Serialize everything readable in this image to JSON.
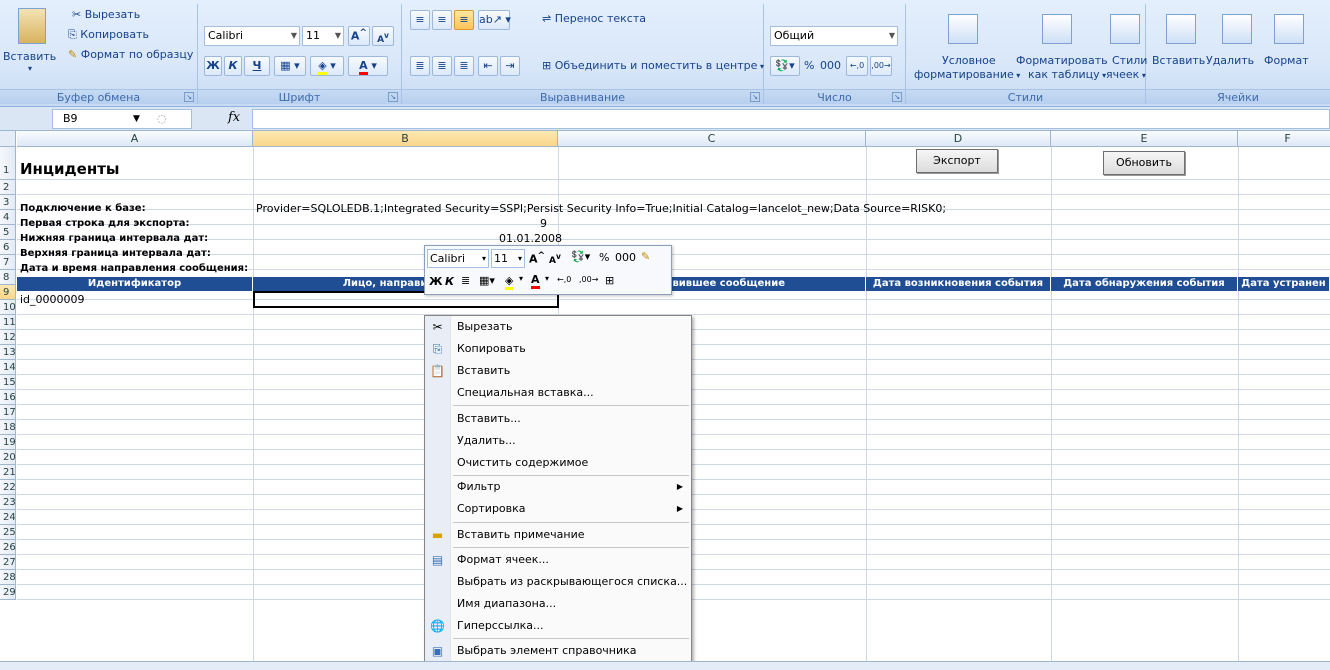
{
  "ribbon": {
    "clipboard": {
      "paste_label": "Вставить",
      "cut_label": "Вырезать",
      "copy_label": "Копировать",
      "format_painter_label": "Формат по образцу",
      "group_label": "Буфер обмена"
    },
    "font": {
      "font_name": "Calibri",
      "font_size": "11",
      "bold": "Ж",
      "italic": "К",
      "underline": "Ч",
      "group_label": "Шрифт"
    },
    "alignment": {
      "wrap_text_label": "Перенос текста",
      "merge_center_label": "Объединить и поместить в центре",
      "group_label": "Выравнивание"
    },
    "number": {
      "format_value": "Общий",
      "percent": "%",
      "thousands": "000",
      "group_label": "Число"
    },
    "styles": {
      "conditional_label_1": "Условное",
      "conditional_label_2": "форматирование",
      "format_table_label_1": "Форматировать",
      "format_table_label_2": "как таблицу",
      "cell_styles_label_1": "Стили",
      "cell_styles_label_2": "ячеек",
      "group_label": "Стили"
    },
    "cells": {
      "insert_label": "Вставить",
      "delete_label": "Удалить",
      "format_label": "Формат",
      "group_label": "Ячейки"
    }
  },
  "formula_bar": {
    "name_box": "B9",
    "fx": "fx",
    "formula": ""
  },
  "sheet": {
    "columns": [
      "A",
      "B",
      "C",
      "D",
      "E",
      "F"
    ],
    "rows": [
      "1",
      "2",
      "3",
      "4",
      "5",
      "6",
      "7",
      "8",
      "9",
      "10",
      "11",
      "12",
      "13",
      "14",
      "15",
      "16",
      "17",
      "18",
      "19",
      "20",
      "21",
      "22",
      "23",
      "24",
      "25",
      "26",
      "27",
      "28",
      "29"
    ],
    "title": "Инциденты",
    "export_button": "Экспорт",
    "refresh_button": "Обновить",
    "labels": {
      "connection": "Подключение к базе:",
      "first_row": "Первая строка для экспорта:",
      "lower_date": "Нижняя граница интервала дат:",
      "upper_date": "Верхняя граница интервала дат:",
      "send_datetime": "Дата и время направления сообщения:"
    },
    "values": {
      "connection": "Provider=SQLOLEDB.1;Integrated Security=SSPI;Persist Security Info=True;Initial Catalog=lancelot_new;Data Source=RISK0;",
      "first_row": "9",
      "lower_date": "01.01.2008"
    },
    "headers": {
      "a": "Идентификатор",
      "b": "Лицо, направившее с",
      "c": "направившее сообщение",
      "d": "Дата возникновения события",
      "e": "Дата обнаружения события",
      "f": "Дата устранен"
    },
    "row9_id": "id_0000009"
  },
  "mini_toolbar": {
    "font_name": "Calibri",
    "font_size": "11",
    "bold": "Ж",
    "italic": "К",
    "percent": "%",
    "thousands": "000"
  },
  "context_menu": {
    "items": [
      {
        "label": "Вырезать",
        "icon": "scissors-icon"
      },
      {
        "label": "Копировать",
        "icon": "copy-icon"
      },
      {
        "label": "Вставить",
        "icon": "paste-icon"
      },
      {
        "label": "Специальная вставка...",
        "icon": ""
      },
      {
        "label": "Вставить...",
        "icon": ""
      },
      {
        "label": "Удалить...",
        "icon": ""
      },
      {
        "label": "Очистить содержимое",
        "icon": ""
      },
      {
        "label": "Фильтр",
        "icon": ""
      },
      {
        "label": "Сортировка",
        "icon": ""
      },
      {
        "label": "Вставить примечание",
        "icon": "comment-icon"
      },
      {
        "label": "Формат ячеек...",
        "icon": "format-cells-icon"
      },
      {
        "label": "Выбрать из раскрывающегося списка...",
        "icon": ""
      },
      {
        "label": "Имя диапазона...",
        "icon": ""
      },
      {
        "label": "Гиперссылка...",
        "icon": "hyperlink-icon"
      },
      {
        "label": "Выбрать элемент справочника",
        "icon": "reference-icon"
      }
    ]
  }
}
